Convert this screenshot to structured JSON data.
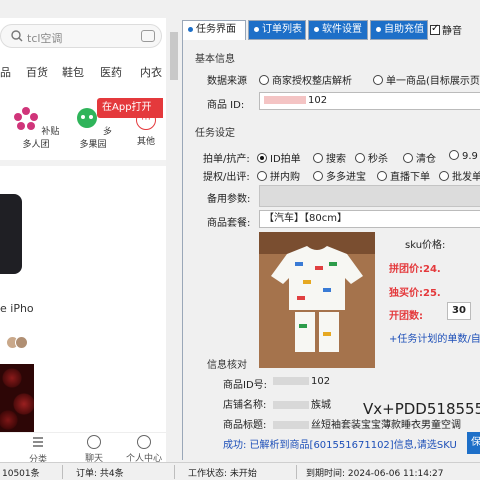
{
  "phone": {
    "search_placeholder": "tcl空调",
    "categories": [
      "品",
      "百货",
      "鞋包",
      "医药",
      "内衣"
    ],
    "app_button": "在App打开 >",
    "icons": [
      {
        "label": "补贴多人团",
        "icon": "flower-icon"
      },
      {
        "label": "多多果园",
        "icon": "orchard-icon"
      },
      {
        "label": "其他",
        "icon": "other-icon"
      }
    ],
    "product_text": "e iPho",
    "bottom_nav": [
      {
        "label": "分类",
        "icon": "category-icon"
      },
      {
        "label": "聊天",
        "icon": "chat-icon"
      },
      {
        "label": "个人中心",
        "icon": "profile-icon"
      }
    ]
  },
  "tabs": [
    {
      "label": "任务界面",
      "active": true
    },
    {
      "label": "订单列表",
      "active": false
    },
    {
      "label": "软件设置",
      "active": false
    },
    {
      "label": "自助充值",
      "active": false
    }
  ],
  "mute": {
    "label": "静音",
    "checked": true
  },
  "basic": {
    "section_title": "基本信息",
    "source_label": "数据来源",
    "source_options": [
      "商家授权整店解析",
      "单一商品(目标展示页"
    ],
    "source_selected": 1,
    "product_id_label": "商品 ID:",
    "product_id_suffix": "102"
  },
  "task": {
    "section_title": "任务设定",
    "method_label": "拍单/抗产:",
    "method_options": [
      "ID拍单",
      "搜索",
      "秒杀",
      "清仓",
      "9.9"
    ],
    "method_selected": 0,
    "coupon_label": "提权/出评:",
    "coupon_options": [
      "拼内购",
      "多多进宝",
      "直播下单",
      "批发单"
    ],
    "coupon_selected": -1,
    "backup_label": "备用参数:",
    "package_label": "商品套餐:",
    "package_value": "【汽车】【80cm】",
    "sku_price_label": "sku价格:",
    "group_price_label": "拼团价:",
    "group_price_value": "24.",
    "single_price_label": "独买价:",
    "single_price_value": "25.",
    "open_count_label": "开团数:",
    "open_count_value": "30",
    "plan_link": "+任务计划的单数/自"
  },
  "verify": {
    "section_title": "信息核对",
    "product_id_label": "商品ID号:",
    "product_id_value": "102",
    "shop_label": "店铺名称:",
    "shop_value": "族城",
    "title_label": "商品标题:",
    "title_value": "丝短袖套装宝宝薄款睡衣男童空调",
    "watermark": "Vx+PDD518555",
    "success_msg": "成功: 已解析到商品[601551671102]信息,请选SKU",
    "save_btn": "保"
  },
  "status": {
    "left_value": "10501条",
    "orders": "订单: 共4条",
    "work_state": "工作状态: 未开始",
    "expire": "到期时间: 2024-06-06 11:14:27"
  },
  "colors": {
    "accent": "#1d6fc8",
    "price_red": "#e4393c",
    "link_blue": "#1d4fb8"
  }
}
